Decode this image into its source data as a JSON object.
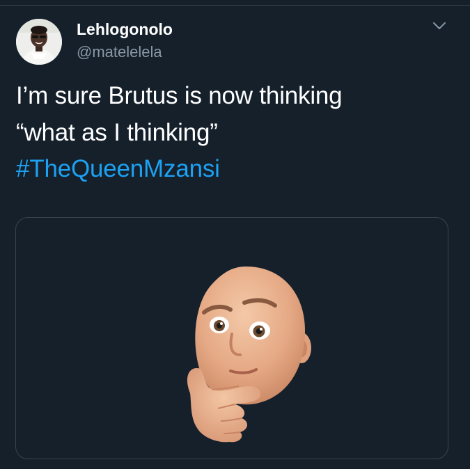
{
  "tweet": {
    "author_name": "Lehlogonolo",
    "author_handle": "@matelelela",
    "text_line_1": "I’m sure Brutus is now thinking",
    "text_line_2": "“what as I thinking”",
    "hashtag": "#TheQueenMzansi",
    "avatar_icon": "avatar-photo",
    "menu_icon": "chevron-down-icon",
    "media_icon": "thinking-memoji-icon"
  },
  "colors": {
    "background": "#15202b",
    "primary_text": "#ffffff",
    "secondary_text": "#8899a6",
    "link": "#1da1f2",
    "border": "#38444d"
  }
}
